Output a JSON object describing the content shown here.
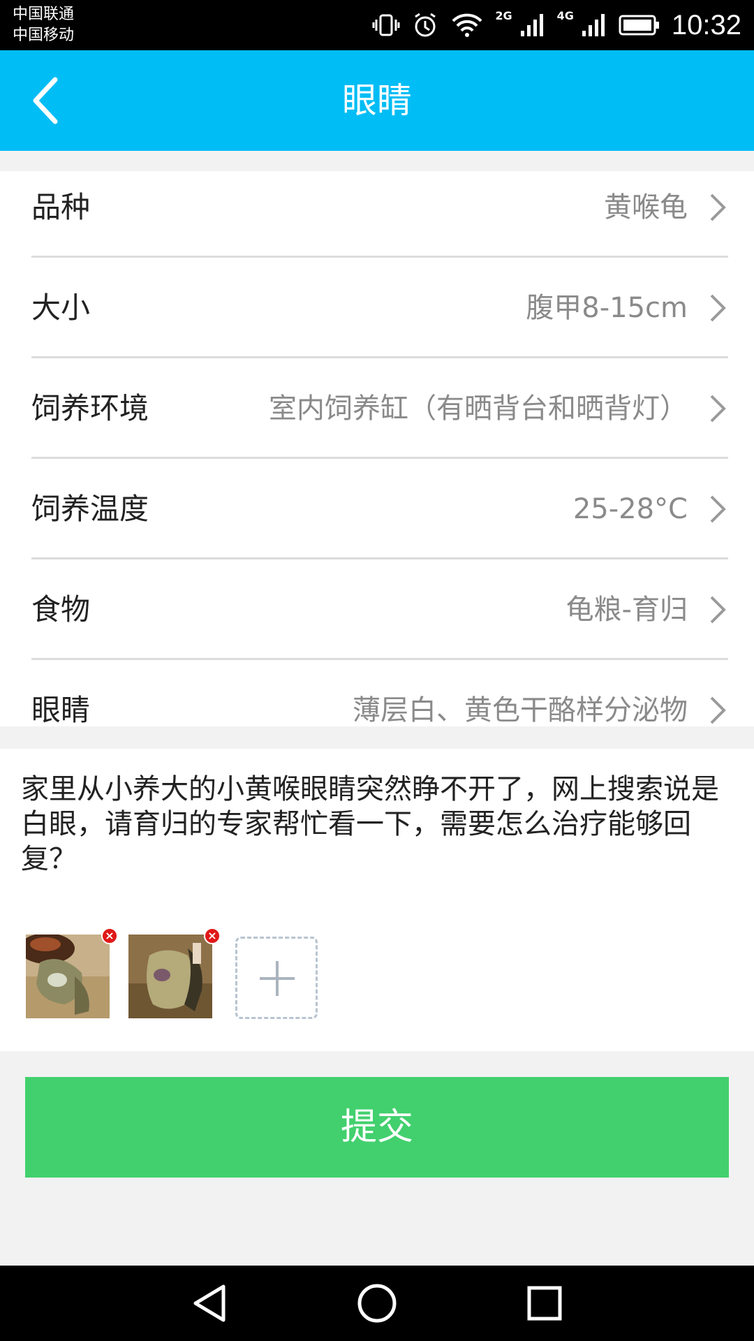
{
  "status_bar": {
    "carrier1": "中国联通",
    "carrier2": "中国移动",
    "net1": "2G",
    "net2": "4G",
    "time": "10:32"
  },
  "app_bar": {
    "title": "眼睛",
    "background": "#00bdf5"
  },
  "info_rows": [
    {
      "label": "品种",
      "value": "黄喉龟"
    },
    {
      "label": "大小",
      "value": "腹甲8-15cm"
    },
    {
      "label": "饲养环境",
      "value": "室内饲养缸（有晒背台和晒背灯）"
    },
    {
      "label": "饲养温度",
      "value": "25-28°C"
    },
    {
      "label": "食物",
      "value": "龟粮-育归"
    },
    {
      "label": "眼睛",
      "value": "薄层白、黄色干酪样分泌物"
    }
  ],
  "description": "家里从小养大的小黄喉眼睛突然睁不开了，网上搜索说是白眼，请育归的专家帮忙看一下，需要怎么治疗能够回复？",
  "photos": [
    {
      "name": "turtle-photo-1"
    },
    {
      "name": "turtle-photo-2"
    }
  ],
  "submit": {
    "label": "提交",
    "color": "#42d06e"
  }
}
